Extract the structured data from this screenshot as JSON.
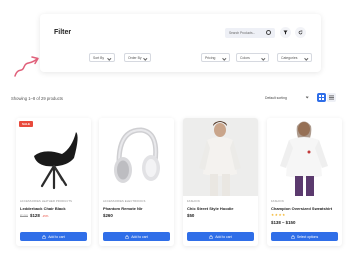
{
  "filter": {
    "title": "Filter",
    "search_placeholder": "Search Products...",
    "dropdowns": [
      "Sort By",
      "Order By",
      "Pricing",
      "Colors",
      "Categories"
    ]
  },
  "listing": {
    "results_text": "Showing 1–8 of 29 products",
    "sort_value": "Default sorting"
  },
  "products": [
    {
      "badge": "SALE",
      "category": "ACCESSORIES   LEATHER PRODUCTS",
      "name": "Ledderback Chair Black",
      "old_price": "$150",
      "price": "$128",
      "discount": "-15%",
      "button": "Add to cart"
    },
    {
      "category": "ACCESSORIES   ELECTRONICS",
      "name": "Phantom Remote Nir",
      "price": "$260",
      "button": "Add to cart"
    },
    {
      "category": "FASHION",
      "name": "Chic Street Style Hoodie",
      "price": "$50",
      "button": "Add to cart"
    },
    {
      "category": "FASHION",
      "name": "Champion Oversized Sweatshirt",
      "stars": "★★★★",
      "price": "$138 – $150",
      "button": "Select options"
    }
  ],
  "colors": {
    "accent": "#2f6ee8",
    "sale": "#e84a3c",
    "arrow": "#e0607a"
  }
}
